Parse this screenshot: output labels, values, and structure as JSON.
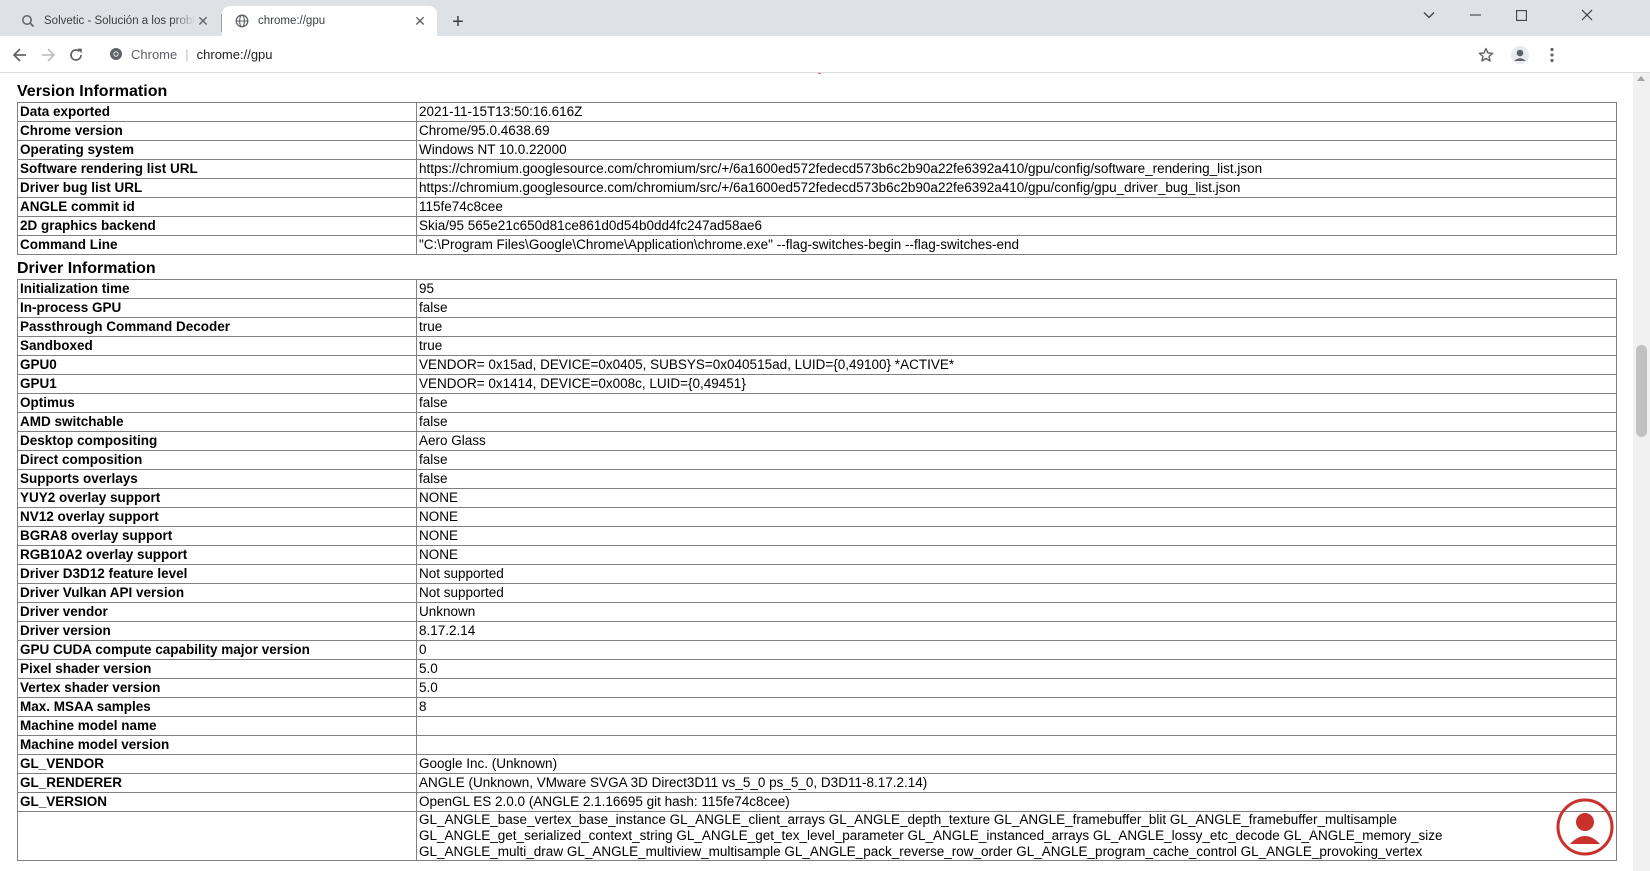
{
  "tabs": [
    {
      "title": "Solvetic - Solución a los problemas",
      "active": false
    },
    {
      "title": "chrome://gpu",
      "active": true
    }
  ],
  "window_controls": {
    "minimize": "−",
    "maximize": "☐",
    "close": "✕",
    "tab_list": "⌄"
  },
  "toolbar": {
    "site_chip": "Chrome",
    "url": "chrome://gpu"
  },
  "version_information": {
    "heading": "Version Information",
    "rows": [
      {
        "key": "Data exported",
        "value": "2021-11-15T13:50:16.616Z"
      },
      {
        "key": "Chrome version",
        "value": "Chrome/95.0.4638.69"
      },
      {
        "key": "Operating system",
        "value": "Windows NT 10.0.22000"
      },
      {
        "key": "Software rendering list URL",
        "value": "https://chromium.googlesource.com/chromium/src/+/6a1600ed572fedecd573b6c2b90a22fe6392a410/gpu/config/software_rendering_list.json"
      },
      {
        "key": "Driver bug list URL",
        "value": "https://chromium.googlesource.com/chromium/src/+/6a1600ed572fedecd573b6c2b90a22fe6392a410/gpu/config/gpu_driver_bug_list.json"
      },
      {
        "key": "ANGLE commit id",
        "value": "115fe74c8cee"
      },
      {
        "key": "2D graphics backend",
        "value": "Skia/95 565e21c650d81ce861d0d54b0dd4fc247ad58ae6"
      },
      {
        "key": "Command Line",
        "value": "\"C:\\Program Files\\Google\\Chrome\\Application\\chrome.exe\" --flag-switches-begin --flag-switches-end"
      }
    ]
  },
  "driver_information": {
    "heading": "Driver Information",
    "rows": [
      {
        "key": "Initialization time",
        "value": "95"
      },
      {
        "key": "In-process GPU",
        "value": "false"
      },
      {
        "key": "Passthrough Command Decoder",
        "value": "true"
      },
      {
        "key": "Sandboxed",
        "value": "true"
      },
      {
        "key": "GPU0",
        "value": "VENDOR= 0x15ad, DEVICE=0x0405, SUBSYS=0x040515ad, LUID={0,49100} *ACTIVE*"
      },
      {
        "key": "GPU1",
        "value": "VENDOR= 0x1414, DEVICE=0x008c, LUID={0,49451}"
      },
      {
        "key": "Optimus",
        "value": "false"
      },
      {
        "key": "AMD switchable",
        "value": "false"
      },
      {
        "key": "Desktop compositing",
        "value": "Aero Glass"
      },
      {
        "key": "Direct composition",
        "value": "false"
      },
      {
        "key": "Supports overlays",
        "value": "false"
      },
      {
        "key": "YUY2 overlay support",
        "value": "NONE"
      },
      {
        "key": "NV12 overlay support",
        "value": "NONE"
      },
      {
        "key": "BGRA8 overlay support",
        "value": "NONE"
      },
      {
        "key": "RGB10A2 overlay support",
        "value": "NONE"
      },
      {
        "key": "Driver D3D12 feature level",
        "value": "Not supported"
      },
      {
        "key": "Driver Vulkan API version",
        "value": "Not supported"
      },
      {
        "key": "Driver vendor",
        "value": "Unknown"
      },
      {
        "key": "Driver version",
        "value": "8.17.2.14"
      },
      {
        "key": "GPU CUDA compute capability major version",
        "value": "0"
      },
      {
        "key": "Pixel shader version",
        "value": "5.0"
      },
      {
        "key": "Vertex shader version",
        "value": "5.0"
      },
      {
        "key": "Max. MSAA samples",
        "value": "8"
      },
      {
        "key": "Machine model name",
        "value": ""
      },
      {
        "key": "Machine model version",
        "value": ""
      },
      {
        "key": "GL_VENDOR",
        "value": "Google Inc. (Unknown)"
      },
      {
        "key": "GL_RENDERER",
        "value": "ANGLE (Unknown, VMware SVGA 3D Direct3D11 vs_5_0 ps_5_0, D3D11-8.17.2.14)"
      },
      {
        "key": "GL_VERSION",
        "value": "OpenGL ES 2.0.0 (ANGLE 2.1.16695 git hash: 115fe74c8cee)"
      }
    ],
    "extensions_lines": [
      "GL_ANGLE_base_vertex_base_instance GL_ANGLE_client_arrays GL_ANGLE_depth_texture GL_ANGLE_framebuffer_blit GL_ANGLE_framebuffer_multisample",
      "GL_ANGLE_get_serialized_context_string GL_ANGLE_get_tex_level_parameter GL_ANGLE_instanced_arrays GL_ANGLE_lossy_etc_decode GL_ANGLE_memory_size",
      "GL_ANGLE_multi_draw GL_ANGLE_multiview_multisample GL_ANGLE_pack_reverse_row_order GL_ANGLE_program_cache_control GL_ANGLE_provoking_vertex"
    ]
  },
  "icons": {
    "tab_inactive": "search-icon",
    "tab_active": "globe-icon",
    "back": "arrow-left-icon",
    "forward": "arrow-right-icon",
    "reload": "reload-icon",
    "bookmark": "star-icon",
    "profile": "account-icon",
    "menu": "kebab-menu-icon"
  },
  "colors": {
    "tabstrip_bg": "#dee1e6",
    "table_border": "#808080",
    "watermark_red": "#c8312c"
  }
}
